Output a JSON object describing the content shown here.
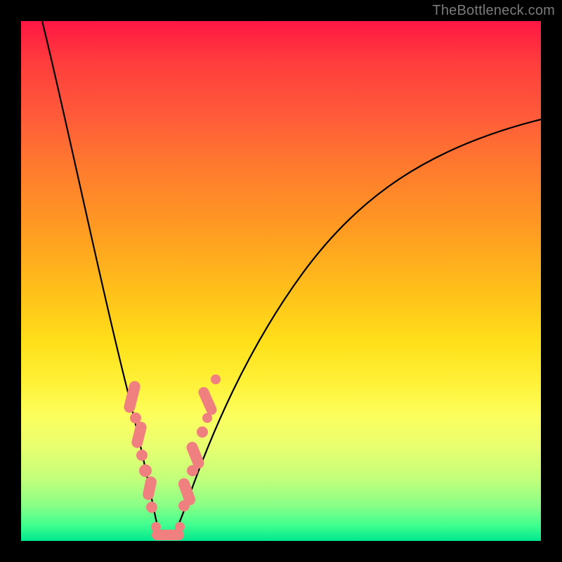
{
  "watermark": "TheBottleneck.com",
  "chart_data": {
    "type": "line",
    "title": "",
    "xlabel": "",
    "ylabel": "",
    "xlim": [
      0,
      100
    ],
    "ylim": [
      0,
      100
    ],
    "grid": false,
    "series": [
      {
        "name": "bottleneck-curve",
        "x": [
          4,
          6,
          8,
          10,
          12,
          14,
          16,
          18,
          20,
          22,
          23,
          24,
          25,
          26,
          27,
          28,
          30,
          32,
          35,
          40,
          45,
          50,
          55,
          60,
          65,
          70,
          75,
          80,
          85,
          90,
          95,
          100
        ],
        "y": [
          100,
          90,
          80,
          70,
          60,
          50,
          42,
          34,
          26,
          18,
          14,
          10,
          6,
          3,
          1,
          0,
          2,
          6,
          12,
          22,
          32,
          40,
          47,
          53,
          58,
          62,
          66,
          70,
          73,
          76,
          78,
          80
        ]
      }
    ],
    "points_left_arm": [
      {
        "x": 19,
        "y": 30
      },
      {
        "x": 19.5,
        "y": 27
      },
      {
        "x": 20,
        "y": 25
      },
      {
        "x": 20.5,
        "y": 22
      },
      {
        "x": 21,
        "y": 19
      },
      {
        "x": 21.5,
        "y": 17
      },
      {
        "x": 22,
        "y": 14
      },
      {
        "x": 22.5,
        "y": 12
      },
      {
        "x": 23,
        "y": 10
      },
      {
        "x": 23.5,
        "y": 8
      },
      {
        "x": 24,
        "y": 6
      }
    ],
    "points_right_arm": [
      {
        "x": 29,
        "y": 4
      },
      {
        "x": 29.5,
        "y": 6
      },
      {
        "x": 30,
        "y": 8
      },
      {
        "x": 30.5,
        "y": 10
      },
      {
        "x": 31,
        "y": 12
      },
      {
        "x": 31.5,
        "y": 15
      },
      {
        "x": 32,
        "y": 18
      },
      {
        "x": 32.5,
        "y": 21
      },
      {
        "x": 33,
        "y": 24
      },
      {
        "x": 33.5,
        "y": 27
      }
    ],
    "points_bottom": [
      {
        "x": 25,
        "y": 1
      },
      {
        "x": 25.8,
        "y": 0.5
      },
      {
        "x": 26.6,
        "y": 0.3
      },
      {
        "x": 27.4,
        "y": 0.3
      },
      {
        "x": 28.2,
        "y": 0.6
      },
      {
        "x": 29,
        "y": 1.2
      }
    ],
    "description": "V-shaped bottleneck curve with minimum near x≈27. Salmon dots cluster along both arms near the trough and along the bottom. Background is a vertical rainbow gradient red (top) to green (bottom) inside a black frame."
  },
  "colors": {
    "frame": "#000000",
    "curve": "#000000",
    "dots": "#f08080",
    "watermark": "#7a7a7a"
  }
}
